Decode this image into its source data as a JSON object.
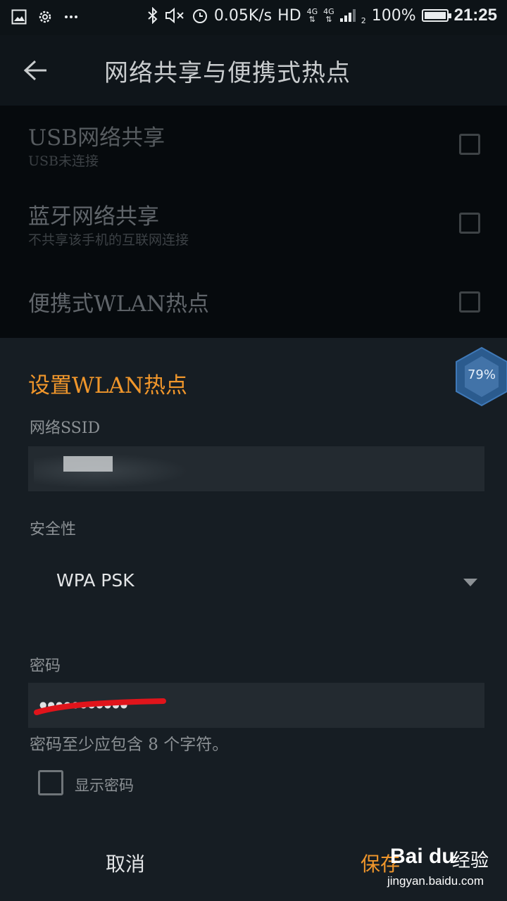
{
  "status_bar": {
    "speed": "0.05K/s",
    "hd": "HD",
    "net1": "4G",
    "net2": "4G",
    "sim": "2",
    "battery_text": "100%",
    "battery_level": 1.0,
    "time": "21:25",
    "icons": [
      "image-icon",
      "gear-icon",
      "more-icon",
      "bluetooth-icon",
      "mute-icon",
      "alarm-icon",
      "signal-icon",
      "battery-icon"
    ]
  },
  "appbar": {
    "title": "网络共享与便携式热点"
  },
  "settings": [
    {
      "title": "USB网络共享",
      "subtitle": "USB未连接"
    },
    {
      "title": "蓝牙网络共享",
      "subtitle": "不共享该手机的互联网连接"
    },
    {
      "title": "便携式WLAN热点",
      "subtitle": ""
    }
  ],
  "dialog": {
    "title": "设置WLAN热点",
    "ssid_label": "网络SSID",
    "security_label": "安全性",
    "security_value": "WPA PSK",
    "password_label": "密码",
    "password_mask": "●●●●●●●●●●●",
    "password_hint": "密码至少应包含 8 个字符。",
    "show_password_label": "显示密码",
    "cancel": "取消",
    "save": "保存"
  },
  "overlay_badge": {
    "text": "79%"
  },
  "watermark": {
    "logo": "Bai du",
    "brand": "经验",
    "url": "jingyan.baidu.com"
  },
  "colors": {
    "accent": "#f0962b",
    "background": "#0b1014",
    "dialog": "#161d23"
  }
}
